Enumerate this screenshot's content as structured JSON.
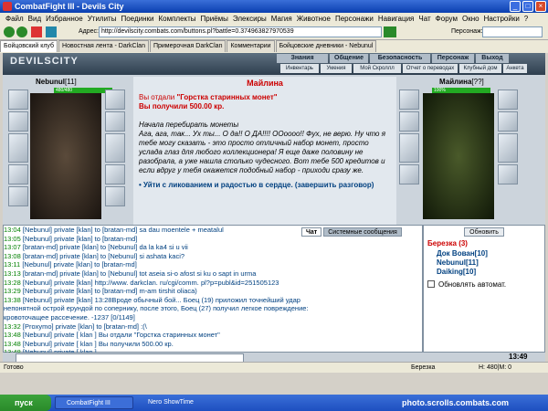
{
  "window": {
    "title": "CombatFight III - Devils City"
  },
  "menu": [
    "Файл",
    "Вид",
    "Избранное",
    "Утилиты",
    "Поединки",
    "Комплекты",
    "Приёмы",
    "Элексиры",
    "Магия",
    "Животное",
    "Персонажи",
    "Навигация",
    "Чат",
    "Форум",
    "Окно",
    "Настройки",
    "?"
  ],
  "address": {
    "label": "Адрес:",
    "value": "http://devilscity.combats.com/buttons.pl?battle=0.374963827970539",
    "person_label": "Персонаж:"
  },
  "tabs": [
    "Бойцовский клуб",
    "Новостная лента - DarkClan",
    "Примерочная DarkClan",
    "Комментарии",
    "Бойцовские дневники - Nebunul"
  ],
  "game": {
    "logo": "DEVILSCITY",
    "nav_top": [
      "Знания",
      "Общение",
      "Безопасность",
      "Персонаж",
      "Выход"
    ],
    "nav_bottom": [
      "Инвентарь",
      "Умения",
      "Мой Скроллл",
      "Отчет о переводах",
      "Клубный дом",
      "Анкета"
    ],
    "left_player": {
      "name": "Nebunul",
      "level": "[11]",
      "hp": "480/480"
    },
    "right_player": {
      "name": "Майлина",
      "level": "[??]",
      "hp": "100%"
    },
    "message": {
      "title": "Майлина",
      "gave_prefix": "Вы отдали ",
      "gave_item": "\"Горстка старинных монет\"",
      "received": "Вы получили 500.00 кр.",
      "body": "Начала перебирать монеты\nАга, ага, так... Ух ты... О да!! О ДА!!!! ООоооо!! Фух, не верю. Ну что я тебе могу сказать - это просто отличный набор монет, просто услада глаз для любого коллекционера! Я еще даже половину не разобрала, а уже нашла столько чудесного. Вот тебе 500 кредитов и если вдруг у тебя окажется подобный набор - приходи сразу же.",
      "link": "• Уйти с ликованием и радостью в сердце. (завершить разговор)"
    },
    "chat_tabs": [
      "Чат",
      "Системные сообщения"
    ],
    "chat": [
      {
        "time": "13:04",
        "text": "[Nebunul] private [klan] to [bratan-md] sa dau moentele + meatalul"
      },
      {
        "time": "13:05",
        "text": "[Nebunul] private [klan] to [bratan-md]"
      },
      {
        "time": "13:07",
        "text": "[bratan-md] private [klan] to [Nebunul] da la ka4 si u vii"
      },
      {
        "time": "13:08",
        "text": "[bratan-md] private [klan] to [Nebunul] si ashata kaci?"
      },
      {
        "time": "13:11",
        "text": "[Nebunul] private [klan] to [bratan-md]"
      },
      {
        "time": "13:13",
        "text": "[bratan-md] private [klan] to [Nebunul] tot aseia si-o afost si ku o sapt in urma"
      },
      {
        "time": "13:28",
        "text": "[Nebunul] private [klan] http://www. darkclan. ru/cgi/comm. pl?p=publ&id=251505123"
      },
      {
        "time": "13:29",
        "text": "[Nebunul] private [klan] to [bratan-md] m-am tirshit oliaca)"
      },
      {
        "time": "13:38",
        "text": "[Nebunul] private [klan] 13:28Вроде обычный бой... Боец (19) приложил точнейший удар"
      },
      {
        "time": "",
        "text": "непонятной острой ерундой по сопернику, после этого, Боец (27) получил легкое повреждение:"
      },
      {
        "time": "",
        "text": "кровоточащее рассечение. -1237 [0/1149]"
      },
      {
        "time": "13:32",
        "text": "[Proxymo] private [klan] to [bratan-md] :(\\"
      },
      {
        "time": "13:48",
        "text": "[Nebunul] private [ klan ] Вы отдали \"Горстка старинных монет\""
      },
      {
        "time": "13:48",
        "text": "[Nebunul] private [ klan ] Вы получили 500.00 кр."
      },
      {
        "time": "13:48",
        "text": "[Nebunul] private [ klan ]"
      }
    ],
    "side": {
      "refresh": "Обновить",
      "location": "Березка (3)",
      "players": [
        "Док Вован[10]",
        "Nebunul[11]",
        "Daiking[10]"
      ],
      "auto": "Обновлять автомат."
    },
    "clock": "13:49"
  },
  "status": {
    "left": "Готово",
    "right": "Березка",
    "right2": "H: 480|M: 0"
  },
  "taskbar": {
    "start": "пуск",
    "tasks": [
      "CombatFight III",
      "Nero ShowTime"
    ],
    "watermark": "photo.scrolls.combats.com"
  }
}
